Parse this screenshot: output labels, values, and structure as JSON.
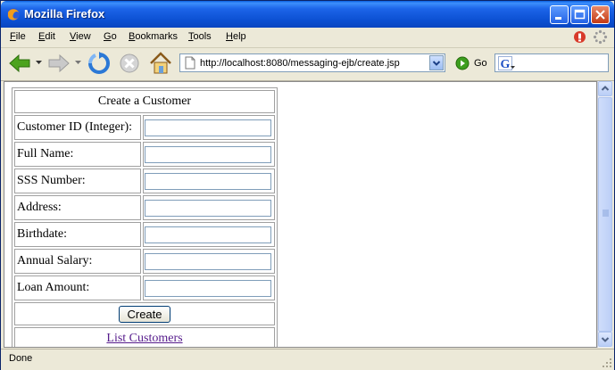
{
  "window": {
    "title": "Mozilla Firefox"
  },
  "menu": [
    "File",
    "Edit",
    "View",
    "Go",
    "Bookmarks",
    "Tools",
    "Help"
  ],
  "toolbar": {
    "url": "http://localhost:8080/messaging-ejb/create.jsp",
    "go_label": "Go"
  },
  "form": {
    "title": "Create a Customer",
    "fields": [
      "Customer ID (Integer):",
      "Full Name:",
      "SSS Number:",
      "Address:",
      "Birthdate:",
      "Annual Salary:",
      "Loan Amount:"
    ],
    "submit_label": "Create",
    "link_label": "List Customers"
  },
  "status": {
    "text": "Done"
  },
  "colors": {
    "titlebar": "#0b4fd1",
    "link_visited": "#551a8b"
  }
}
